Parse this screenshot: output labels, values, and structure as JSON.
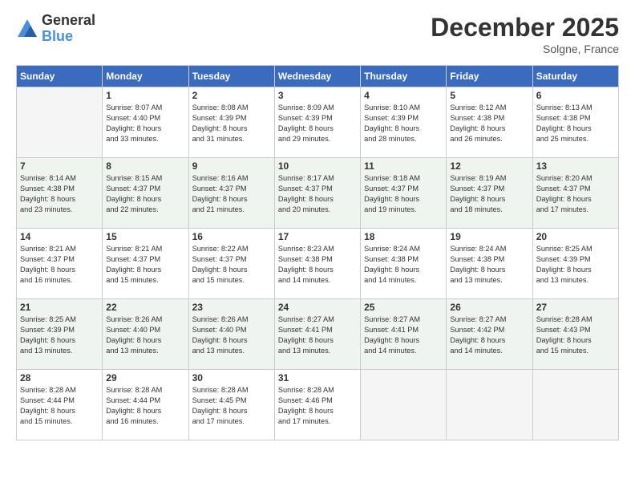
{
  "logo": {
    "general": "General",
    "blue": "Blue"
  },
  "title": "December 2025",
  "location": "Solgne, France",
  "days_header": [
    "Sunday",
    "Monday",
    "Tuesday",
    "Wednesday",
    "Thursday",
    "Friday",
    "Saturday"
  ],
  "weeks": [
    [
      {
        "day": "",
        "info": ""
      },
      {
        "day": "1",
        "info": "Sunrise: 8:07 AM\nSunset: 4:40 PM\nDaylight: 8 hours\nand 33 minutes."
      },
      {
        "day": "2",
        "info": "Sunrise: 8:08 AM\nSunset: 4:39 PM\nDaylight: 8 hours\nand 31 minutes."
      },
      {
        "day": "3",
        "info": "Sunrise: 8:09 AM\nSunset: 4:39 PM\nDaylight: 8 hours\nand 29 minutes."
      },
      {
        "day": "4",
        "info": "Sunrise: 8:10 AM\nSunset: 4:39 PM\nDaylight: 8 hours\nand 28 minutes."
      },
      {
        "day": "5",
        "info": "Sunrise: 8:12 AM\nSunset: 4:38 PM\nDaylight: 8 hours\nand 26 minutes."
      },
      {
        "day": "6",
        "info": "Sunrise: 8:13 AM\nSunset: 4:38 PM\nDaylight: 8 hours\nand 25 minutes."
      }
    ],
    [
      {
        "day": "7",
        "info": "Sunrise: 8:14 AM\nSunset: 4:38 PM\nDaylight: 8 hours\nand 23 minutes."
      },
      {
        "day": "8",
        "info": "Sunrise: 8:15 AM\nSunset: 4:37 PM\nDaylight: 8 hours\nand 22 minutes."
      },
      {
        "day": "9",
        "info": "Sunrise: 8:16 AM\nSunset: 4:37 PM\nDaylight: 8 hours\nand 21 minutes."
      },
      {
        "day": "10",
        "info": "Sunrise: 8:17 AM\nSunset: 4:37 PM\nDaylight: 8 hours\nand 20 minutes."
      },
      {
        "day": "11",
        "info": "Sunrise: 8:18 AM\nSunset: 4:37 PM\nDaylight: 8 hours\nand 19 minutes."
      },
      {
        "day": "12",
        "info": "Sunrise: 8:19 AM\nSunset: 4:37 PM\nDaylight: 8 hours\nand 18 minutes."
      },
      {
        "day": "13",
        "info": "Sunrise: 8:20 AM\nSunset: 4:37 PM\nDaylight: 8 hours\nand 17 minutes."
      }
    ],
    [
      {
        "day": "14",
        "info": "Sunrise: 8:21 AM\nSunset: 4:37 PM\nDaylight: 8 hours\nand 16 minutes."
      },
      {
        "day": "15",
        "info": "Sunrise: 8:21 AM\nSunset: 4:37 PM\nDaylight: 8 hours\nand 15 minutes."
      },
      {
        "day": "16",
        "info": "Sunrise: 8:22 AM\nSunset: 4:37 PM\nDaylight: 8 hours\nand 15 minutes."
      },
      {
        "day": "17",
        "info": "Sunrise: 8:23 AM\nSunset: 4:38 PM\nDaylight: 8 hours\nand 14 minutes."
      },
      {
        "day": "18",
        "info": "Sunrise: 8:24 AM\nSunset: 4:38 PM\nDaylight: 8 hours\nand 14 minutes."
      },
      {
        "day": "19",
        "info": "Sunrise: 8:24 AM\nSunset: 4:38 PM\nDaylight: 8 hours\nand 13 minutes."
      },
      {
        "day": "20",
        "info": "Sunrise: 8:25 AM\nSunset: 4:39 PM\nDaylight: 8 hours\nand 13 minutes."
      }
    ],
    [
      {
        "day": "21",
        "info": "Sunrise: 8:25 AM\nSunset: 4:39 PM\nDaylight: 8 hours\nand 13 minutes."
      },
      {
        "day": "22",
        "info": "Sunrise: 8:26 AM\nSunset: 4:40 PM\nDaylight: 8 hours\nand 13 minutes."
      },
      {
        "day": "23",
        "info": "Sunrise: 8:26 AM\nSunset: 4:40 PM\nDaylight: 8 hours\nand 13 minutes."
      },
      {
        "day": "24",
        "info": "Sunrise: 8:27 AM\nSunset: 4:41 PM\nDaylight: 8 hours\nand 13 minutes."
      },
      {
        "day": "25",
        "info": "Sunrise: 8:27 AM\nSunset: 4:41 PM\nDaylight: 8 hours\nand 14 minutes."
      },
      {
        "day": "26",
        "info": "Sunrise: 8:27 AM\nSunset: 4:42 PM\nDaylight: 8 hours\nand 14 minutes."
      },
      {
        "day": "27",
        "info": "Sunrise: 8:28 AM\nSunset: 4:43 PM\nDaylight: 8 hours\nand 15 minutes."
      }
    ],
    [
      {
        "day": "28",
        "info": "Sunrise: 8:28 AM\nSunset: 4:44 PM\nDaylight: 8 hours\nand 15 minutes."
      },
      {
        "day": "29",
        "info": "Sunrise: 8:28 AM\nSunset: 4:44 PM\nDaylight: 8 hours\nand 16 minutes."
      },
      {
        "day": "30",
        "info": "Sunrise: 8:28 AM\nSunset: 4:45 PM\nDaylight: 8 hours\nand 17 minutes."
      },
      {
        "day": "31",
        "info": "Sunrise: 8:28 AM\nSunset: 4:46 PM\nDaylight: 8 hours\nand 17 minutes."
      },
      {
        "day": "",
        "info": ""
      },
      {
        "day": "",
        "info": ""
      },
      {
        "day": "",
        "info": ""
      }
    ]
  ]
}
